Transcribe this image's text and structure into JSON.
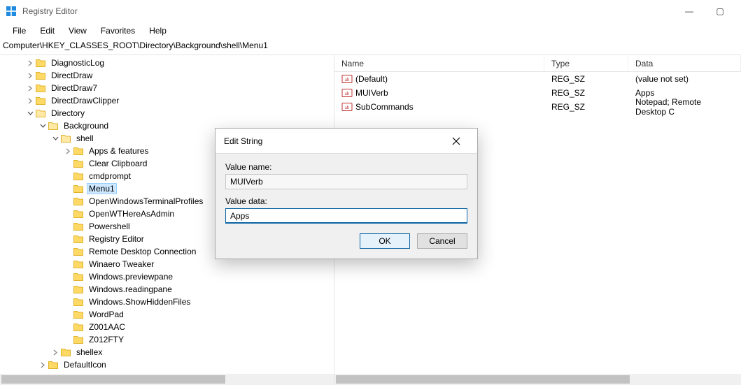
{
  "window": {
    "title": "Registry Editor",
    "controls": {
      "minimize": "—",
      "maximize": "▢"
    }
  },
  "menubar": [
    "File",
    "Edit",
    "View",
    "Favorites",
    "Help"
  ],
  "address": "Computer\\HKEY_CLASSES_ROOT\\Directory\\Background\\shell\\Menu1",
  "tree": [
    {
      "depth": 2,
      "exp": "closed",
      "label": "DiagnosticLog"
    },
    {
      "depth": 2,
      "exp": "closed",
      "label": "DirectDraw"
    },
    {
      "depth": 2,
      "exp": "closed",
      "label": "DirectDraw7"
    },
    {
      "depth": 2,
      "exp": "closed",
      "label": "DirectDrawClipper"
    },
    {
      "depth": 2,
      "exp": "open",
      "label": "Directory"
    },
    {
      "depth": 3,
      "exp": "open",
      "label": "Background"
    },
    {
      "depth": 4,
      "exp": "open",
      "label": "shell"
    },
    {
      "depth": 5,
      "exp": "closed",
      "label": "Apps & features"
    },
    {
      "depth": 5,
      "exp": "none",
      "label": "Clear Clipboard"
    },
    {
      "depth": 5,
      "exp": "none",
      "label": "cmdprompt"
    },
    {
      "depth": 5,
      "exp": "none",
      "label": "Menu1",
      "selected": true
    },
    {
      "depth": 5,
      "exp": "none",
      "label": "OpenWindowsTerminalProfiles"
    },
    {
      "depth": 5,
      "exp": "none",
      "label": "OpenWTHereAsAdmin"
    },
    {
      "depth": 5,
      "exp": "none",
      "label": "Powershell"
    },
    {
      "depth": 5,
      "exp": "none",
      "label": "Registry Editor"
    },
    {
      "depth": 5,
      "exp": "none",
      "label": "Remote Desktop Connection"
    },
    {
      "depth": 5,
      "exp": "none",
      "label": "Winaero Tweaker"
    },
    {
      "depth": 5,
      "exp": "none",
      "label": "Windows.previewpane"
    },
    {
      "depth": 5,
      "exp": "none",
      "label": "Windows.readingpane"
    },
    {
      "depth": 5,
      "exp": "none",
      "label": "Windows.ShowHiddenFiles"
    },
    {
      "depth": 5,
      "exp": "none",
      "label": "WordPad"
    },
    {
      "depth": 5,
      "exp": "none",
      "label": "Z001AAC"
    },
    {
      "depth": 5,
      "exp": "none",
      "label": "Z012FTY"
    },
    {
      "depth": 4,
      "exp": "closed",
      "label": "shellex"
    },
    {
      "depth": 3,
      "exp": "closed",
      "label": "DefaultIcon"
    }
  ],
  "list": {
    "headers": {
      "name": "Name",
      "type": "Type",
      "data": "Data"
    },
    "rows": [
      {
        "name": "(Default)",
        "type": "REG_SZ",
        "data": "(value not set)"
      },
      {
        "name": "MUIVerb",
        "type": "REG_SZ",
        "data": "Apps"
      },
      {
        "name": "SubCommands",
        "type": "REG_SZ",
        "data": "Notepad; Remote Desktop C"
      }
    ]
  },
  "dialog": {
    "title": "Edit String",
    "value_name_label": "Value name:",
    "value_name": "MUIVerb",
    "value_data_label": "Value data:",
    "value_data": "Apps",
    "ok": "OK",
    "cancel": "Cancel"
  }
}
